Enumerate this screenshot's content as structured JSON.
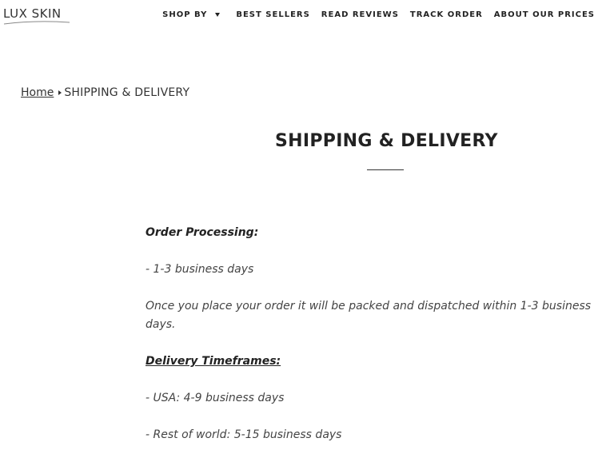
{
  "header": {
    "logo_text": "LUX SKIN",
    "nav": [
      {
        "label": "SHOP BY"
      },
      {
        "label": "BEST SELLERS"
      },
      {
        "label": "READ REVIEWS"
      },
      {
        "label": "TRACK ORDER"
      },
      {
        "label": "ABOUT OUR PRICES"
      }
    ]
  },
  "breadcrumb": {
    "home": "Home",
    "current": "SHIPPING & DELIVERY"
  },
  "page": {
    "title": "SHIPPING & DELIVERY"
  },
  "content": {
    "order_processing_heading": "Order Processing:",
    "order_processing_time": "- 1-3 business days",
    "order_processing_text": "Once you place your order it will be packed and dispatched within 1-3 business days.",
    "delivery_heading": "Delivery Timeframes:",
    "delivery_usa": "- USA: 4-9 business days",
    "delivery_world": "- Rest of world: 5-15 business days"
  }
}
